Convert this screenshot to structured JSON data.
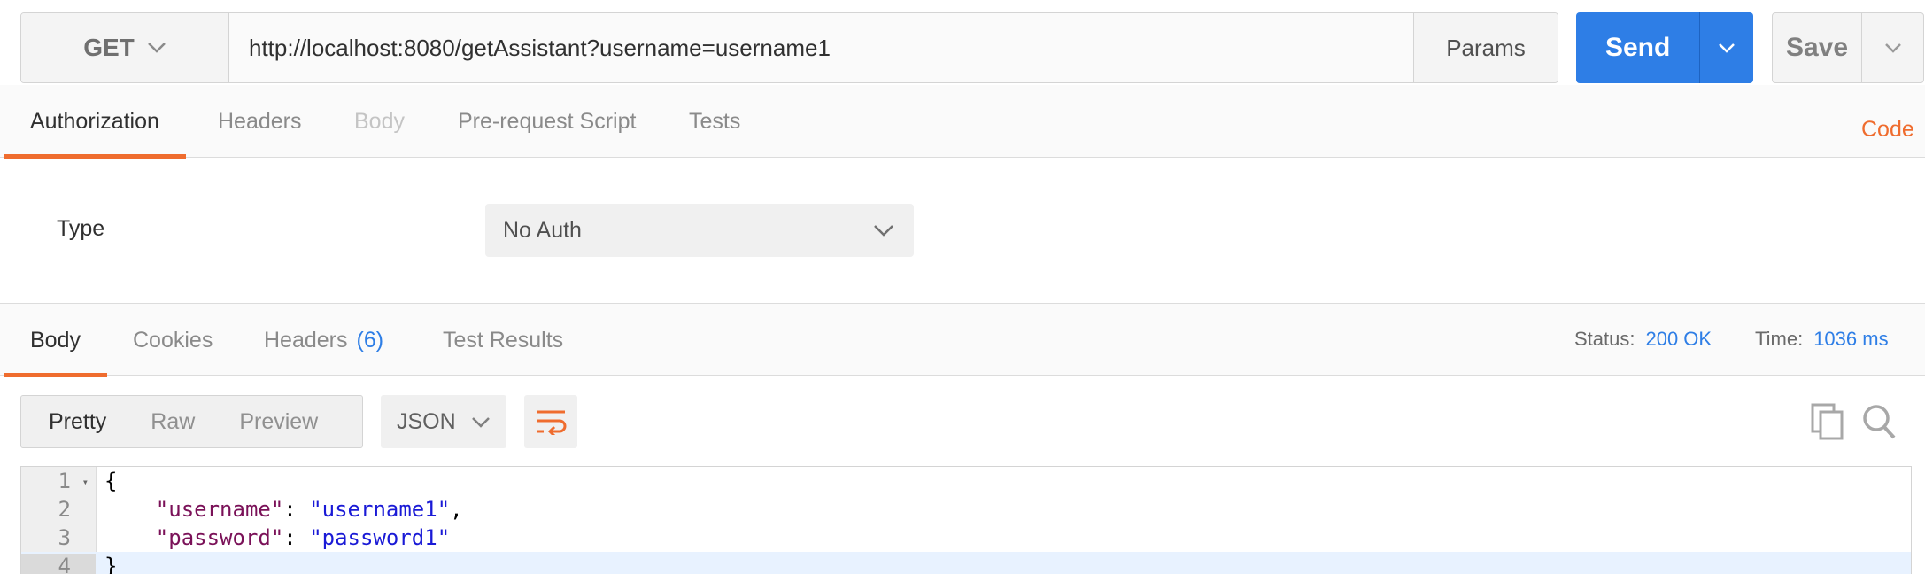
{
  "request": {
    "method": "GET",
    "url": "http://localhost:8080/getAssistant?username=username1",
    "params_label": "Params",
    "send_label": "Send",
    "save_label": "Save"
  },
  "request_tabs": [
    {
      "label": "Authorization",
      "state": "active"
    },
    {
      "label": "Headers",
      "state": "normal"
    },
    {
      "label": "Body",
      "state": "disabled"
    },
    {
      "label": "Pre-request Script",
      "state": "normal"
    },
    {
      "label": "Tests",
      "state": "normal"
    }
  ],
  "code_link": "Code",
  "auth": {
    "type_label": "Type",
    "selected": "No Auth"
  },
  "response_tabs": [
    {
      "label": "Body",
      "state": "active"
    },
    {
      "label": "Cookies",
      "state": "normal"
    },
    {
      "label": "Headers",
      "count": "(6)",
      "state": "normal"
    },
    {
      "label": "Test Results",
      "state": "normal"
    }
  ],
  "status": {
    "status_label": "Status:",
    "status_value": "200 OK",
    "time_label": "Time:",
    "time_value": "1036 ms"
  },
  "view_modes": [
    "Pretty",
    "Raw",
    "Preview"
  ],
  "format": "JSON",
  "code_lines": [
    {
      "n": "1",
      "parts": [
        {
          "t": "{",
          "c": "p"
        }
      ]
    },
    {
      "n": "2",
      "parts": [
        {
          "t": "    ",
          "c": "p"
        },
        {
          "t": "\"username\"",
          "c": "key"
        },
        {
          "t": ": ",
          "c": "p"
        },
        {
          "t": "\"username1\"",
          "c": "str"
        },
        {
          "t": ",",
          "c": "p"
        }
      ]
    },
    {
      "n": "3",
      "parts": [
        {
          "t": "    ",
          "c": "p"
        },
        {
          "t": "\"password\"",
          "c": "key"
        },
        {
          "t": ": ",
          "c": "p"
        },
        {
          "t": "\"password1\"",
          "c": "str"
        }
      ]
    },
    {
      "n": "4",
      "parts": [
        {
          "t": "}",
          "c": "p"
        }
      ]
    }
  ],
  "colors": {
    "accent_orange": "#ef6c2e",
    "accent_blue": "#2e7ee6"
  },
  "icons": {
    "method_caret": "chevron-down-icon",
    "send_caret": "chevron-down-icon",
    "save_caret": "chevron-down-icon",
    "auth_caret": "chevron-down-icon",
    "format_caret": "chevron-down-icon",
    "wrap": "wrap-lines-icon",
    "copy": "copy-icon",
    "search": "search-icon"
  }
}
